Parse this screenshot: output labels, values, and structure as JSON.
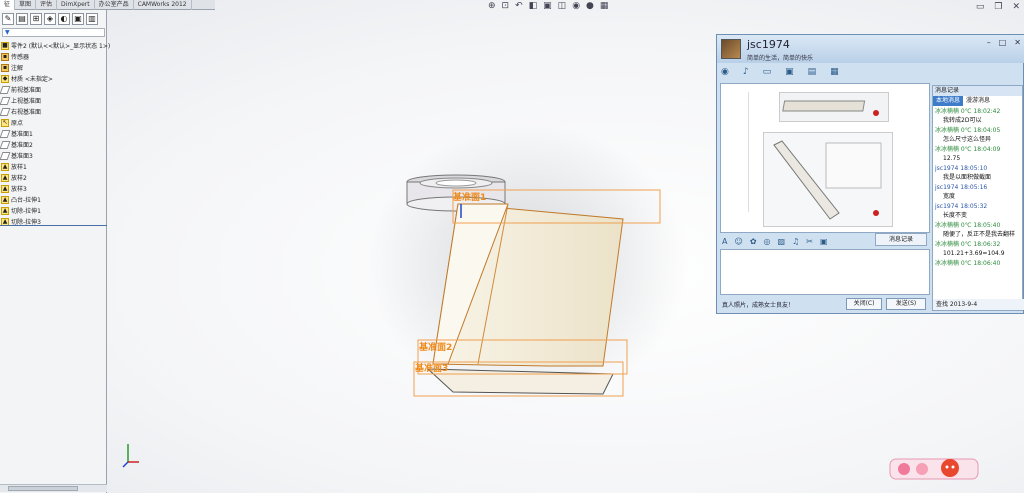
{
  "command_manager": {
    "tabs": [
      "征",
      "草图",
      "评估",
      "DimXpert",
      "办公室产品",
      "CAMWorks 2012"
    ]
  },
  "feature_manager": {
    "filter_icon": "filter-icon",
    "toolbar_icons": [
      "feature-manager-icon",
      "property-manager-icon",
      "configuration-manager-icon",
      "dimxpert-icon",
      "display-manager-icon",
      "camworks-icon",
      "custom-tab-icon"
    ],
    "tree": [
      {
        "label": "零件2 (默认<<默认>_显示状态 1>)",
        "icon": "part"
      },
      {
        "label": "传感器",
        "icon": "folder"
      },
      {
        "label": "注解",
        "icon": "folder"
      },
      {
        "label": "材质 <未指定>",
        "icon": "material"
      },
      {
        "label": "前视基准面",
        "icon": "plane"
      },
      {
        "label": "上视基准面",
        "icon": "plane"
      },
      {
        "label": "右视基准面",
        "icon": "plane"
      },
      {
        "label": "原点",
        "icon": "origin"
      },
      {
        "label": "基准面1",
        "icon": "plane"
      },
      {
        "label": "基准面2",
        "icon": "plane"
      },
      {
        "label": "基准面3",
        "icon": "plane"
      },
      {
        "label": "放样1",
        "icon": "feature"
      },
      {
        "label": "放样2",
        "icon": "feature"
      },
      {
        "label": "放样3",
        "icon": "feature"
      },
      {
        "label": "凸台-拉伸1",
        "icon": "feature"
      },
      {
        "label": "切除-拉伸1",
        "icon": "feature"
      },
      {
        "label": "切除-拉伸3",
        "icon": "feature"
      }
    ]
  },
  "viewport": {
    "plane_labels": [
      "基准面1",
      "基准面2",
      "基准面3"
    ]
  },
  "chat": {
    "name": "jsc1974",
    "signature": "简单的生活，简单的快乐",
    "history_title": "消息记录",
    "history_tabs": [
      "本地消息",
      "漫游消息"
    ],
    "messages": [
      {
        "meta": "冰冰楠楠 0℃ 18:02:42",
        "text": "我转成2D可以",
        "self": false
      },
      {
        "meta": "冰冰楠楠 0℃ 18:04:05",
        "text": "怎么尺寸这么怪异",
        "self": false
      },
      {
        "meta": "冰冰楠楠 0℃ 18:04:09",
        "text": "12.75",
        "self": false
      },
      {
        "meta": "jsc1974 18:05:10",
        "text": "我是以面积做截面",
        "self": true
      },
      {
        "meta": "jsc1974 18:05:16",
        "text": "宽度",
        "self": true
      },
      {
        "meta": "jsc1974 18:05:32",
        "text": "长度不变",
        "self": true
      },
      {
        "meta": "冰冰楠楠 0℃ 18:05:40",
        "text": "随便了，反正不是我去翻样",
        "self": false
      },
      {
        "meta": "冰冰楠楠 0℃ 18:06:32",
        "text": "101.21+3.69=104.9",
        "self": false
      },
      {
        "meta": "冰冰楠楠 0℃ 18:06:40",
        "text": "",
        "self": false
      }
    ],
    "history_footer": "查找  2013-9-4",
    "record_button": "消息记录",
    "ad_text": "真人照片，成熟女士良友！",
    "close_button": "关闭(C)",
    "send_button": "发送(S)"
  }
}
